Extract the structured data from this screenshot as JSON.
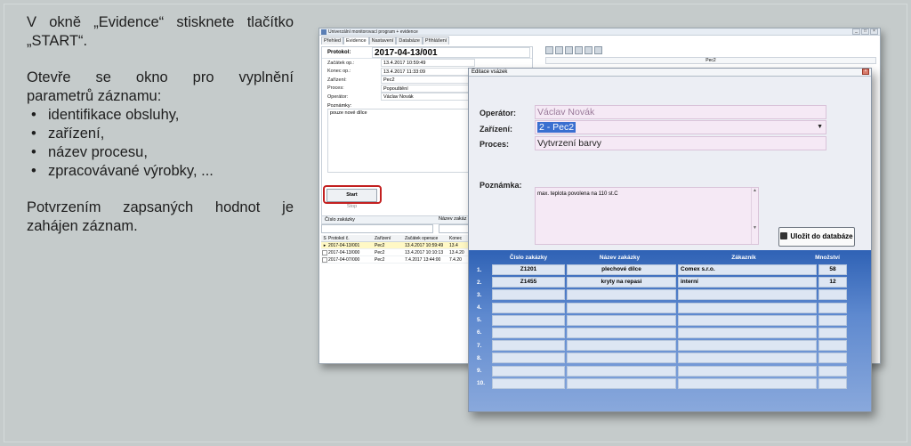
{
  "description": {
    "line1": "V okně „Evidence“ stisknete tlačítko „START“.",
    "para2_line1": [
      "Otevře",
      "se",
      "okno",
      "pro",
      "vyplnění"
    ],
    "para2_line2": "parametrů záznamu:",
    "bullets": [
      "identifikace obsluhy,",
      "zařízení,",
      "název procesu,",
      "zpracovávané výrobky, ..."
    ],
    "para3_line1": [
      "Potvrzením",
      "zapsaných",
      "hodnot",
      "je"
    ],
    "para3_line2": "zahájen záznam."
  },
  "app": {
    "title": "Univerzální monitorovací program + evidence",
    "tabs": [
      "Přehled",
      "Evidence",
      "Nastavení",
      "Databáze",
      "Přihlášení"
    ],
    "active_tab": "Evidence",
    "protocol_label": "Protokol:",
    "protocol_value": "2017-04-13/001",
    "fields": [
      {
        "label": "Začátek op.:",
        "value": "13.4.2017 10:59:49"
      },
      {
        "label": "Konec op.:",
        "value": "13.4.2017 11:33:09"
      },
      {
        "label": "Zařízení:",
        "value": "Pec2"
      },
      {
        "label": "Proces:",
        "value": "Popouštění"
      },
      {
        "label": "Operátor:",
        "value": "Václav Novák"
      }
    ],
    "note_label": "Poznámky:",
    "note_value": "pouze nové dílce",
    "start_label": "Start",
    "stop_label": "Stop",
    "order_header": "Číslo zakázky",
    "order_name_header": "Název zakáz",
    "grid_headers": [
      "S",
      "Protokol č.",
      "Zařízení",
      "Začátek operace",
      "Konec"
    ],
    "grid_rows": [
      [
        "▸",
        "2017-04-13/001",
        "Pec2",
        "13.4.2017 10:59:49",
        "13.4"
      ],
      [
        "",
        "2017-04-13/000",
        "Pec2",
        "13.4.2017 10:10:13",
        "13.4.20"
      ],
      [
        "",
        "2017-04-07/000",
        "Pec2",
        "7.4.2017 13:44:00",
        "7.4.20"
      ]
    ],
    "right_strip": "Pec2"
  },
  "dialog": {
    "title": "Editace vsázek",
    "operator_label": "Operátor:",
    "operator_value": "Václav Novák",
    "device_label": "Zařízení:",
    "device_value": "2 - Pec2",
    "process_label": "Proces:",
    "process_value": "Vytvrzení barvy",
    "note_label": "Poznámka:",
    "note_value": "max. teplota povolena na 110 st.C",
    "save_label": "Uložit do databáze",
    "table_headers": [
      "Číslo zakázky",
      "Název zakázky",
      "Zákazník",
      "Množství"
    ],
    "table_rows": [
      {
        "idx": "1.",
        "cells": [
          "Z1201",
          "plechové dílce",
          "Comex s.r.o.",
          "58"
        ]
      },
      {
        "idx": "2.",
        "cells": [
          "Z1455",
          "kryty na repasi",
          "interní",
          "12"
        ]
      },
      {
        "idx": "3.",
        "cells": [
          "",
          "",
          "",
          ""
        ]
      },
      {
        "idx": "4.",
        "cells": [
          "",
          "",
          "",
          ""
        ]
      },
      {
        "idx": "5.",
        "cells": [
          "",
          "",
          "",
          ""
        ]
      },
      {
        "idx": "6.",
        "cells": [
          "",
          "",
          "",
          ""
        ]
      },
      {
        "idx": "7.",
        "cells": [
          "",
          "",
          "",
          ""
        ]
      },
      {
        "idx": "8.",
        "cells": [
          "",
          "",
          "",
          ""
        ]
      },
      {
        "idx": "9.",
        "cells": [
          "",
          "",
          "",
          ""
        ]
      },
      {
        "idx": "10.",
        "cells": [
          "",
          "",
          "",
          ""
        ]
      }
    ]
  },
  "colors": {
    "background": "#c5cbcb",
    "highlight_border": "#c32020",
    "table_blue": "#2f62b5",
    "field_pink": "#f5e9f5"
  }
}
